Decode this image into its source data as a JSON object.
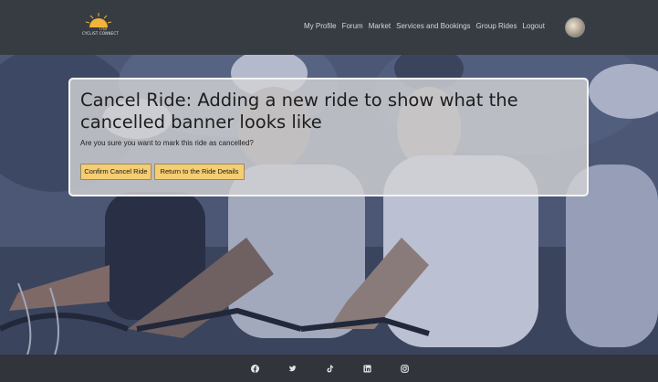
{
  "brand": {
    "name": "CYCLIST CONNECT",
    "script": "The"
  },
  "nav": {
    "items": [
      "My Profile",
      "Forum",
      "Market",
      "Services and Bookings",
      "Group Rides",
      "Logout"
    ]
  },
  "card": {
    "title": "Cancel Ride: Adding a new ride to show what the cancelled banner looks like",
    "message": "Are you sure you want to mark this ride as cancelled?",
    "confirm_label": "Confirm Cancel Ride",
    "return_label": "Return to the Ride Details"
  },
  "footer": {
    "icons": [
      "facebook-icon",
      "twitter-icon",
      "tiktok-icon",
      "linkedin-icon",
      "instagram-icon"
    ]
  },
  "colors": {
    "header_bg": "#373b42",
    "page_bg": "#31353b",
    "button_bg": "#f5cd72",
    "logo_sun": "#f0b43a"
  }
}
